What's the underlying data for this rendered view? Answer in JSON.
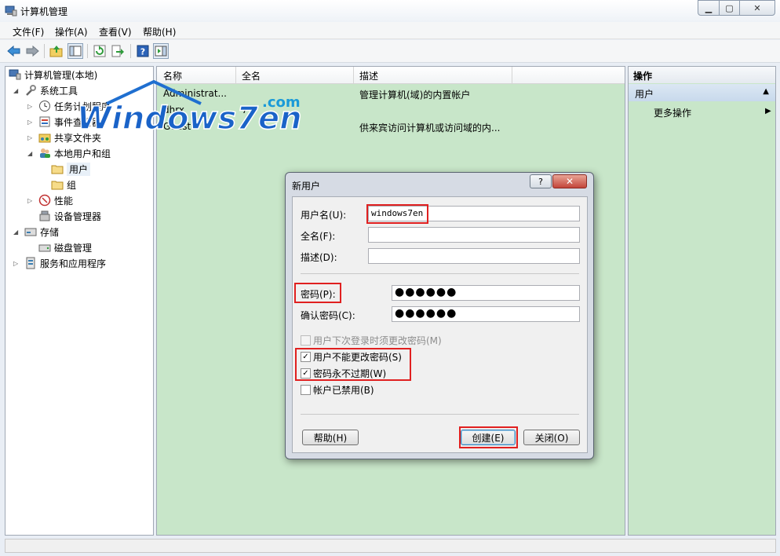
{
  "window": {
    "title": "计算机管理",
    "minimize_glyph": "▁",
    "maximize_glyph": "▢",
    "close_glyph": "✕"
  },
  "menu": [
    "文件(F)",
    "操作(A)",
    "查看(V)",
    "帮助(H)"
  ],
  "toolbar": {
    "icons": [
      "back-arrow-icon",
      "forward-arrow-icon",
      "up-folder-icon",
      "show-hide-tree-icon",
      "refresh-icon",
      "export-list-icon",
      "help-icon",
      "show-hide-action-pane-icon"
    ]
  },
  "tree": {
    "root": "计算机管理(本地)",
    "system_tools": "系统工具",
    "task_scheduler": "任务计划程序",
    "event_viewer": "事件查看器",
    "shared_folders": "共享文件夹",
    "local_users_groups": "本地用户和组",
    "users": "用户",
    "groups": "组",
    "performance": "性能",
    "device_manager": "设备管理器",
    "storage": "存储",
    "disk_management": "磁盘管理",
    "services_apps": "服务和应用程序"
  },
  "list": {
    "columns": [
      "名称",
      "全名",
      "描述"
    ],
    "rows": [
      {
        "name": "Administrat...",
        "fullname": "",
        "desc": "管理计算机(域)的内置帐户"
      },
      {
        "name": "dhrx",
        "fullname": "7",
        "desc": ""
      },
      {
        "name": "Guest",
        "fullname": "",
        "desc": "供来宾访问计算机或访问域的内..."
      }
    ]
  },
  "watermark": {
    "text": "Windows7en",
    "suffix": ".com"
  },
  "actions": {
    "header": "操作",
    "section": "用户",
    "more": "更多操作"
  },
  "dialog": {
    "title": "新用户",
    "help_glyph": "?",
    "close_glyph": "✕",
    "username_label": "用户名(U):",
    "username_value": "windows7en",
    "fullname_label": "全名(F):",
    "fullname_value": "",
    "desc_label": "描述(D):",
    "desc_value": "",
    "password_label": "密码(P):",
    "password_value": "●●●●●●",
    "confirm_label": "确认密码(C):",
    "confirm_value": "●●●●●●",
    "chk_must_change": "用户下次登录时须更改密码(M)",
    "chk_cannot_change": "用户不能更改密码(S)",
    "chk_never_expires": "密码永不过期(W)",
    "chk_disabled": "帐户已禁用(B)",
    "checkmark": "✓",
    "help_button": "帮助(H)",
    "create_button": "创建(E)",
    "close_button": "关闭(O)",
    "highlight_color": "#e02020"
  }
}
